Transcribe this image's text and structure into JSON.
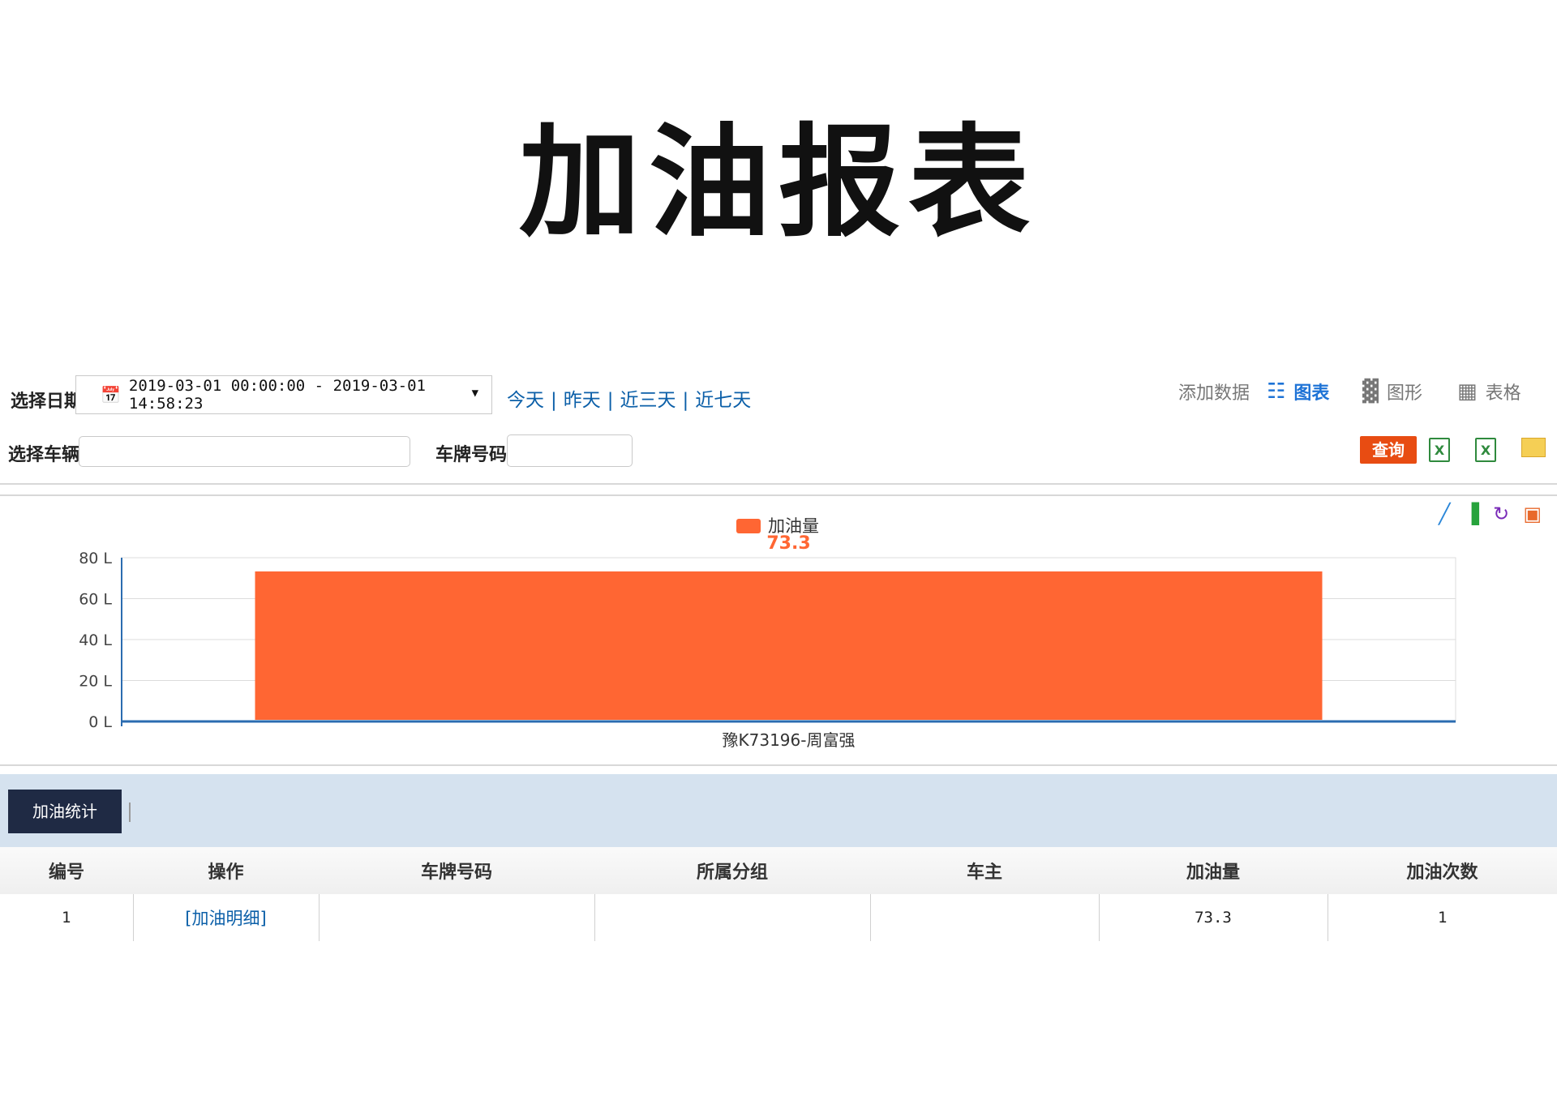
{
  "page_title": "加油报表",
  "filters": {
    "date_label": "选择日期",
    "date_range": "2019-03-01 00:00:00 - 2019-03-01 14:58:23",
    "quick_dates": [
      "今天",
      "昨天",
      "近三天",
      "近七天"
    ],
    "vehicle_label": "选择车辆",
    "vehicle_value": "",
    "plate_label": "车牌号码",
    "plate_value": ""
  },
  "toolbar": {
    "add_data": "添加数据",
    "view_chart": "图表",
    "view_graph": "图形",
    "view_table": "表格",
    "query_button": "查询",
    "accent_color": "#e84c12"
  },
  "chart_data": {
    "type": "bar",
    "title": "",
    "legend": [
      "加油量"
    ],
    "legend_position": "top-center",
    "categories": [
      "豫K73196-周富强"
    ],
    "series": [
      {
        "name": "加油量",
        "values": [
          73.3
        ],
        "color": "#ff6633"
      }
    ],
    "data_labels": [
      "73.3"
    ],
    "y_ticks": [
      "0 L",
      "20 L",
      "40 L",
      "60 L",
      "80 L"
    ],
    "ylim": [
      0,
      80
    ],
    "grid": true,
    "xlabel": "",
    "ylabel": ""
  },
  "tabs": [
    {
      "label": "加油统计",
      "active": true
    }
  ],
  "table": {
    "headers": [
      "编号",
      "操作",
      "车牌号码",
      "所属分组",
      "车主",
      "加油量",
      "加油次数"
    ],
    "rows": [
      {
        "id": "1",
        "action": "[加油明细]",
        "plate": "",
        "group": "",
        "owner": "",
        "amount": "73.3",
        "count": "1"
      }
    ]
  }
}
